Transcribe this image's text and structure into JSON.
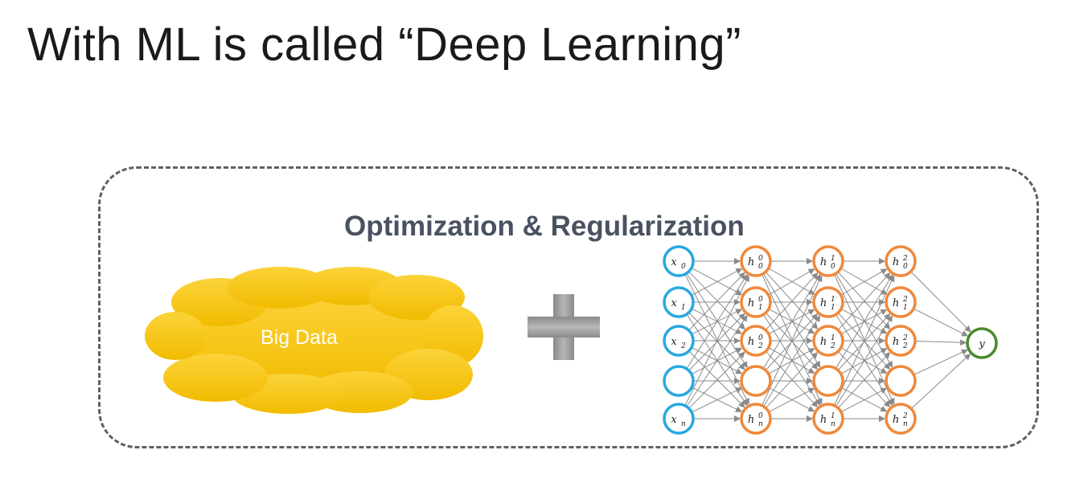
{
  "slide": {
    "title": "With ML is called “Deep Learning”",
    "section_title": "Optimization & Regularization",
    "cloud_label": "Big Data"
  },
  "colors": {
    "cloud_fill": "#f5c614",
    "input_node": "#29a8e0",
    "hidden_node": "#f0883a",
    "output_node": "#4a8a2c",
    "edge": "#8a8a8a",
    "frame": "#5c6068"
  },
  "network": {
    "inputs": [
      {
        "base": "x",
        "sub": "0",
        "sup": ""
      },
      {
        "base": "x",
        "sub": "1",
        "sup": ""
      },
      {
        "base": "x",
        "sub": "2",
        "sup": ""
      },
      {
        "base": "",
        "sub": "",
        "sup": ""
      },
      {
        "base": "x",
        "sub": "n",
        "sup": ""
      }
    ],
    "hidden_layers": [
      [
        {
          "base": "h",
          "sub": "0",
          "sup": "0"
        },
        {
          "base": "h",
          "sub": "1",
          "sup": "0"
        },
        {
          "base": "h",
          "sub": "2",
          "sup": "0"
        },
        {
          "base": "",
          "sub": "",
          "sup": ""
        },
        {
          "base": "h",
          "sub": "n",
          "sup": "0"
        }
      ],
      [
        {
          "base": "h",
          "sub": "0",
          "sup": "1"
        },
        {
          "base": "h",
          "sub": "1",
          "sup": "1"
        },
        {
          "base": "h",
          "sub": "2",
          "sup": "1"
        },
        {
          "base": "",
          "sub": "",
          "sup": ""
        },
        {
          "base": "h",
          "sub": "n",
          "sup": "1"
        }
      ],
      [
        {
          "base": "h",
          "sub": "0",
          "sup": "2"
        },
        {
          "base": "h",
          "sub": "1",
          "sup": "2"
        },
        {
          "base": "h",
          "sub": "2",
          "sup": "2"
        },
        {
          "base": "",
          "sub": "",
          "sup": ""
        },
        {
          "base": "h",
          "sub": "n",
          "sup": "2"
        }
      ]
    ],
    "output": {
      "base": "y",
      "sub": "",
      "sup": ""
    }
  }
}
